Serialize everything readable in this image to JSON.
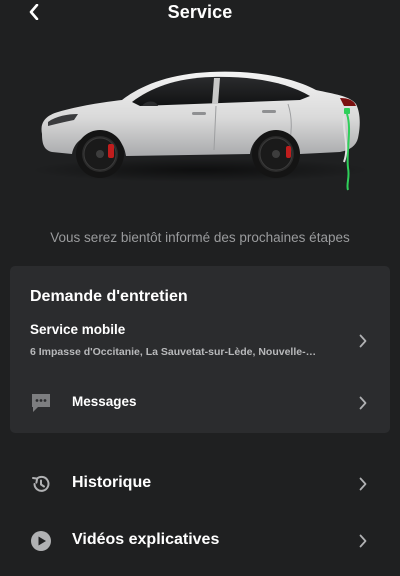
{
  "header": {
    "title": "Service",
    "back_icon": "chevron-left-icon"
  },
  "status": {
    "text": "Vous serez bientôt informé des prochaines étapes"
  },
  "service_card": {
    "title": "Demande d'entretien",
    "mobile": {
      "title": "Service mobile",
      "address": "6 Impasse d'Occitanie, La Sauvetat-sur-Lède, Nouvelle-…"
    },
    "messages": {
      "label": "Messages",
      "icon": "chat-bubble-icon"
    }
  },
  "menu": [
    {
      "label": "Historique",
      "icon": "history-icon"
    },
    {
      "label": "Vidéos explicatives",
      "icon": "play-circle-icon"
    }
  ],
  "colors": {
    "background": "#1f2021",
    "card": "#2b2c2e",
    "muted_text": "#9a9b9d",
    "charge_accent": "#2fcf5a"
  }
}
